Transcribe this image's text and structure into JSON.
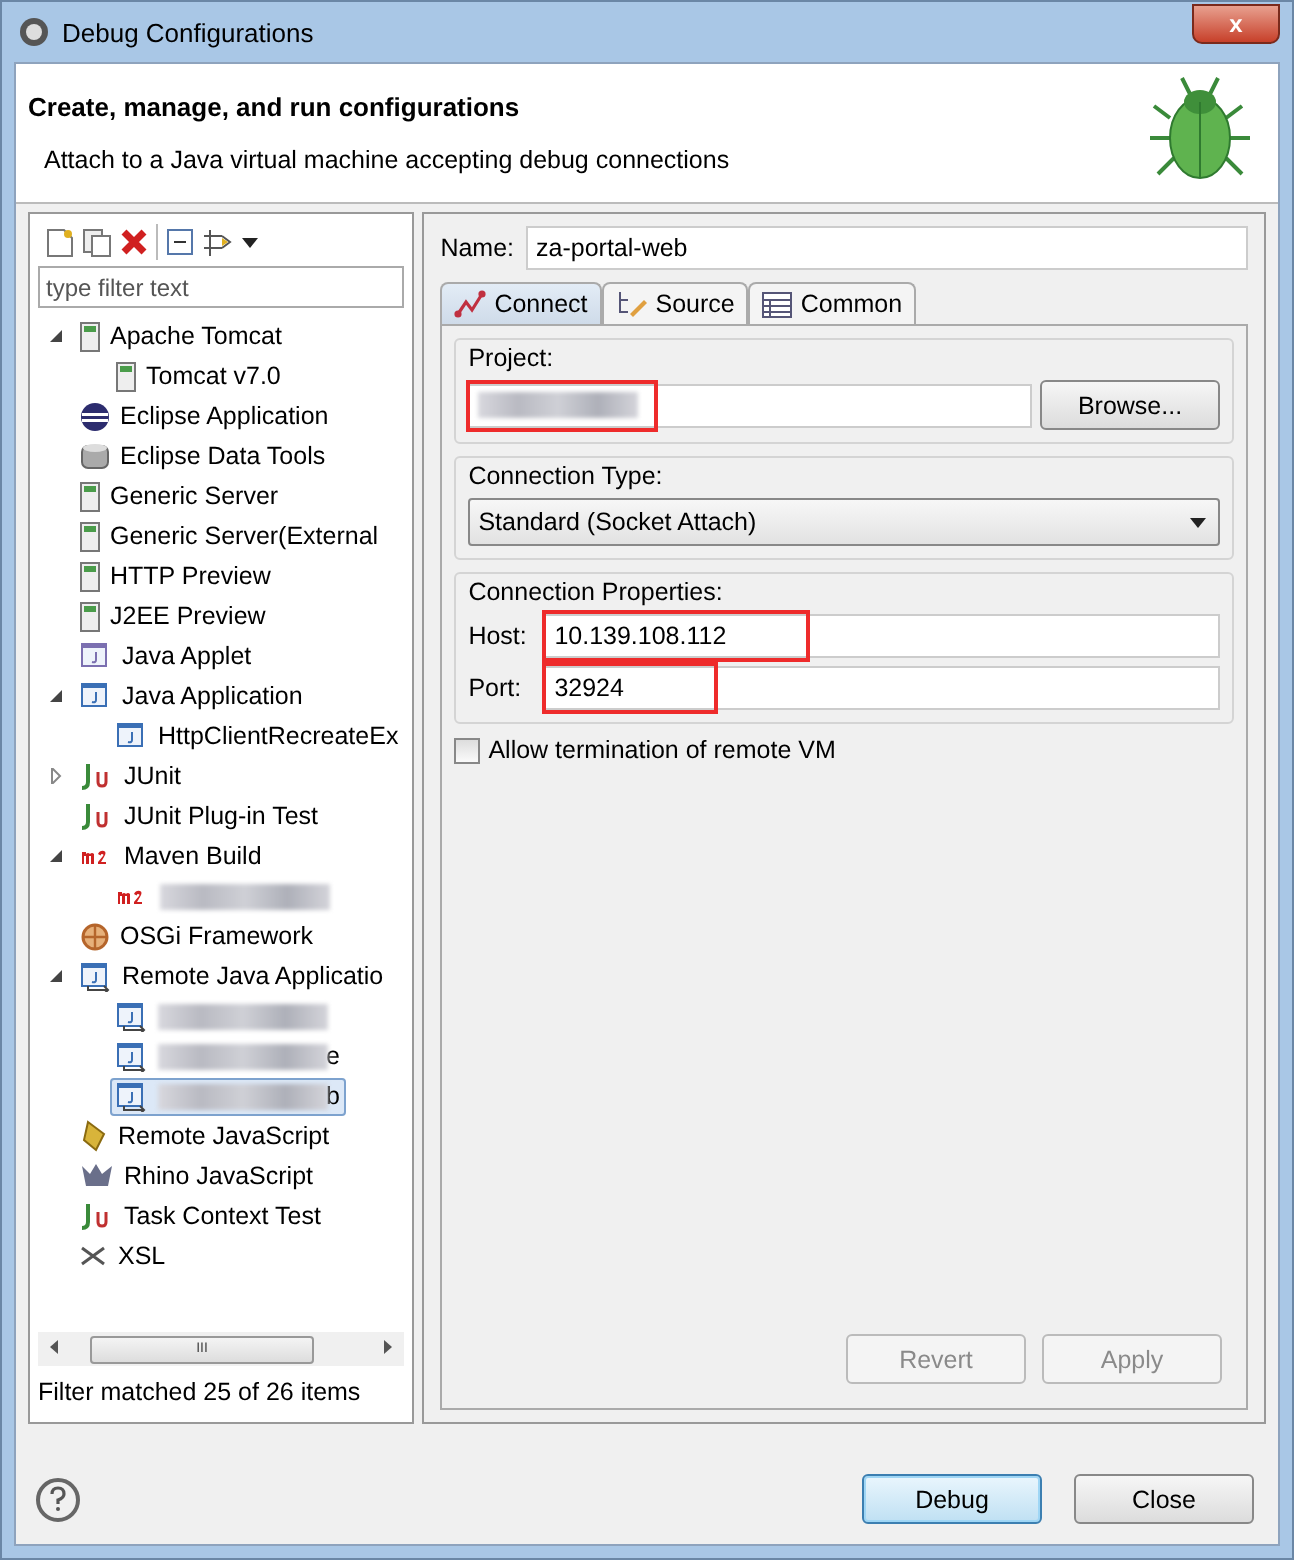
{
  "window": {
    "title": "Debug Configurations",
    "close": "x"
  },
  "header": {
    "title": "Create, manage, and run configurations",
    "subtitle": "Attach to a Java virtual machine accepting debug connections"
  },
  "sidebar": {
    "filter": {
      "placeholder": "type filter text"
    },
    "items": [
      {
        "label": "Apache Tomcat",
        "kind": "server",
        "expanded": true,
        "selected": false,
        "children": [
          {
            "label": "Tomcat v7.0",
            "kind": "server",
            "selected": false
          }
        ]
      },
      {
        "label": "Eclipse Application",
        "kind": "eclipse",
        "selected": false
      },
      {
        "label": "Eclipse Data Tools",
        "kind": "database",
        "selected": false
      },
      {
        "label": "Generic Server",
        "kind": "server",
        "selected": false
      },
      {
        "label": "Generic Server(External",
        "kind": "server",
        "selected": false
      },
      {
        "label": "HTTP Preview",
        "kind": "server",
        "selected": false
      },
      {
        "label": "J2EE Preview",
        "kind": "server",
        "selected": false
      },
      {
        "label": "Java Applet",
        "kind": "applet",
        "selected": false
      },
      {
        "label": "Java Application",
        "kind": "java",
        "expanded": true,
        "selected": false,
        "children": [
          {
            "label": "HttpClientRecreateEx",
            "kind": "java",
            "selected": false
          }
        ]
      },
      {
        "label": "JUnit",
        "kind": "junit",
        "expanded": false,
        "selected": false
      },
      {
        "label": "JUnit Plug-in Test",
        "kind": "junit",
        "selected": false
      },
      {
        "label": "Maven Build",
        "kind": "maven",
        "expanded": true,
        "selected": false,
        "children": [
          {
            "kind": "maven",
            "redacted": true,
            "selected": false
          }
        ]
      },
      {
        "label": "OSGi Framework",
        "kind": "osgi",
        "selected": false
      },
      {
        "label": "Remote Java Applicatio",
        "kind": "remote",
        "expanded": true,
        "selected": false,
        "children": [
          {
            "kind": "remote",
            "redacted": true,
            "selected": false
          },
          {
            "label": "e",
            "kind": "remote",
            "redacted": true,
            "selected": false
          },
          {
            "label": "b",
            "kind": "remote",
            "redacted": true,
            "selected": true
          }
        ]
      },
      {
        "label": "Remote JavaScript",
        "kind": "script",
        "selected": false
      },
      {
        "label": "Rhino JavaScript",
        "kind": "rhino",
        "selected": false
      },
      {
        "label": "Task Context Test",
        "kind": "junit",
        "selected": false
      },
      {
        "label": "XSL",
        "kind": "xsl",
        "selected": false
      }
    ],
    "scroll_thumb": "III",
    "status": "Filter matched 25 of 26 items"
  },
  "form": {
    "name_label": "Name:",
    "name": "za-portal-web",
    "tabs": [
      {
        "label": "Connect",
        "kind": "connect",
        "selected": true
      },
      {
        "label": "Source",
        "kind": "source",
        "selected": false
      },
      {
        "label": "Common",
        "kind": "common",
        "selected": false
      }
    ],
    "project": {
      "label": "Project:",
      "redacted": true,
      "highlighted": true,
      "button": "Browse..."
    },
    "connection_type": {
      "label": "Connection Type:",
      "value": "Standard (Socket Attach)"
    },
    "properties": {
      "label": "Connection Properties:",
      "fields": [
        {
          "label": "Host:",
          "value": "10.139.108.112",
          "highlighted": true
        },
        {
          "label": "Port:",
          "value": "32924",
          "highlighted": true
        }
      ]
    },
    "allow_termination": {
      "label": "Allow termination of remote VM",
      "checked": false
    },
    "buttons": [
      {
        "label": "Revert",
        "disabled": true
      },
      {
        "label": "Apply",
        "disabled": true
      }
    ]
  },
  "footer": {
    "buttons": [
      {
        "label": "Debug",
        "default": true
      },
      {
        "label": "Close",
        "default": false
      }
    ]
  }
}
